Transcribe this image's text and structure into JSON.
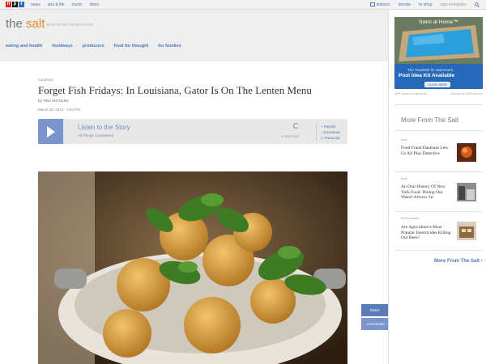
{
  "topbar": {
    "logo": [
      "n",
      "p",
      "r"
    ],
    "logo_colors": [
      "#e2231a",
      "#111111",
      "#2f6fbf"
    ],
    "nav": [
      "news",
      "arts & life",
      "music",
      "listen"
    ],
    "right": [
      "stations",
      "donate",
      "to shop",
      "sign in/register"
    ]
  },
  "brand": {
    "the": "the ",
    "salt": "salt",
    "tagline": "WHAT'S ON YOUR PLATE"
  },
  "section_nav": [
    "eating and health",
    "foodways",
    "producers",
    "food for thought",
    "for foodies"
  ],
  "article": {
    "kicker": "foodways",
    "title": "Forget Fish Fridays: In Louisiana, Gator Is On The Lenten Menu",
    "byline": "by TINA ANTOLINI",
    "dateline": "March 25, 2013  ·  4:54 PM"
  },
  "audio": {
    "listen": "Listen to the Story",
    "program": "All Things Considered",
    "duration": "4 min 9 sec",
    "links": [
      "Playlist",
      "Download",
      "Transcript"
    ]
  },
  "share": {
    "share": "Share",
    "comments": "Comments"
  },
  "ad": {
    "title": "Swim at Home™",
    "sub": "The Treadmill for Swimmers",
    "headline": "Pool Idea Kit Available",
    "cta": "CLICK HERE",
    "thanks": "NPR thanks our sponsors",
    "become": "Become an NPR sponsor"
  },
  "more": {
    "title": "More From The Salt",
    "stories": [
      {
        "kicker": "food",
        "title": "Food Fraud Database Lets Us All Play Detective"
      },
      {
        "kicker": "food",
        "title": "An Oral History Of New York Food: Dining Out Wasn't Always 'In'"
      },
      {
        "kicker": "environment",
        "title": "Are Agriculture's Most Popular Insecticides Killing Our Bees?"
      }
    ],
    "link": "More From The Salt ›"
  }
}
